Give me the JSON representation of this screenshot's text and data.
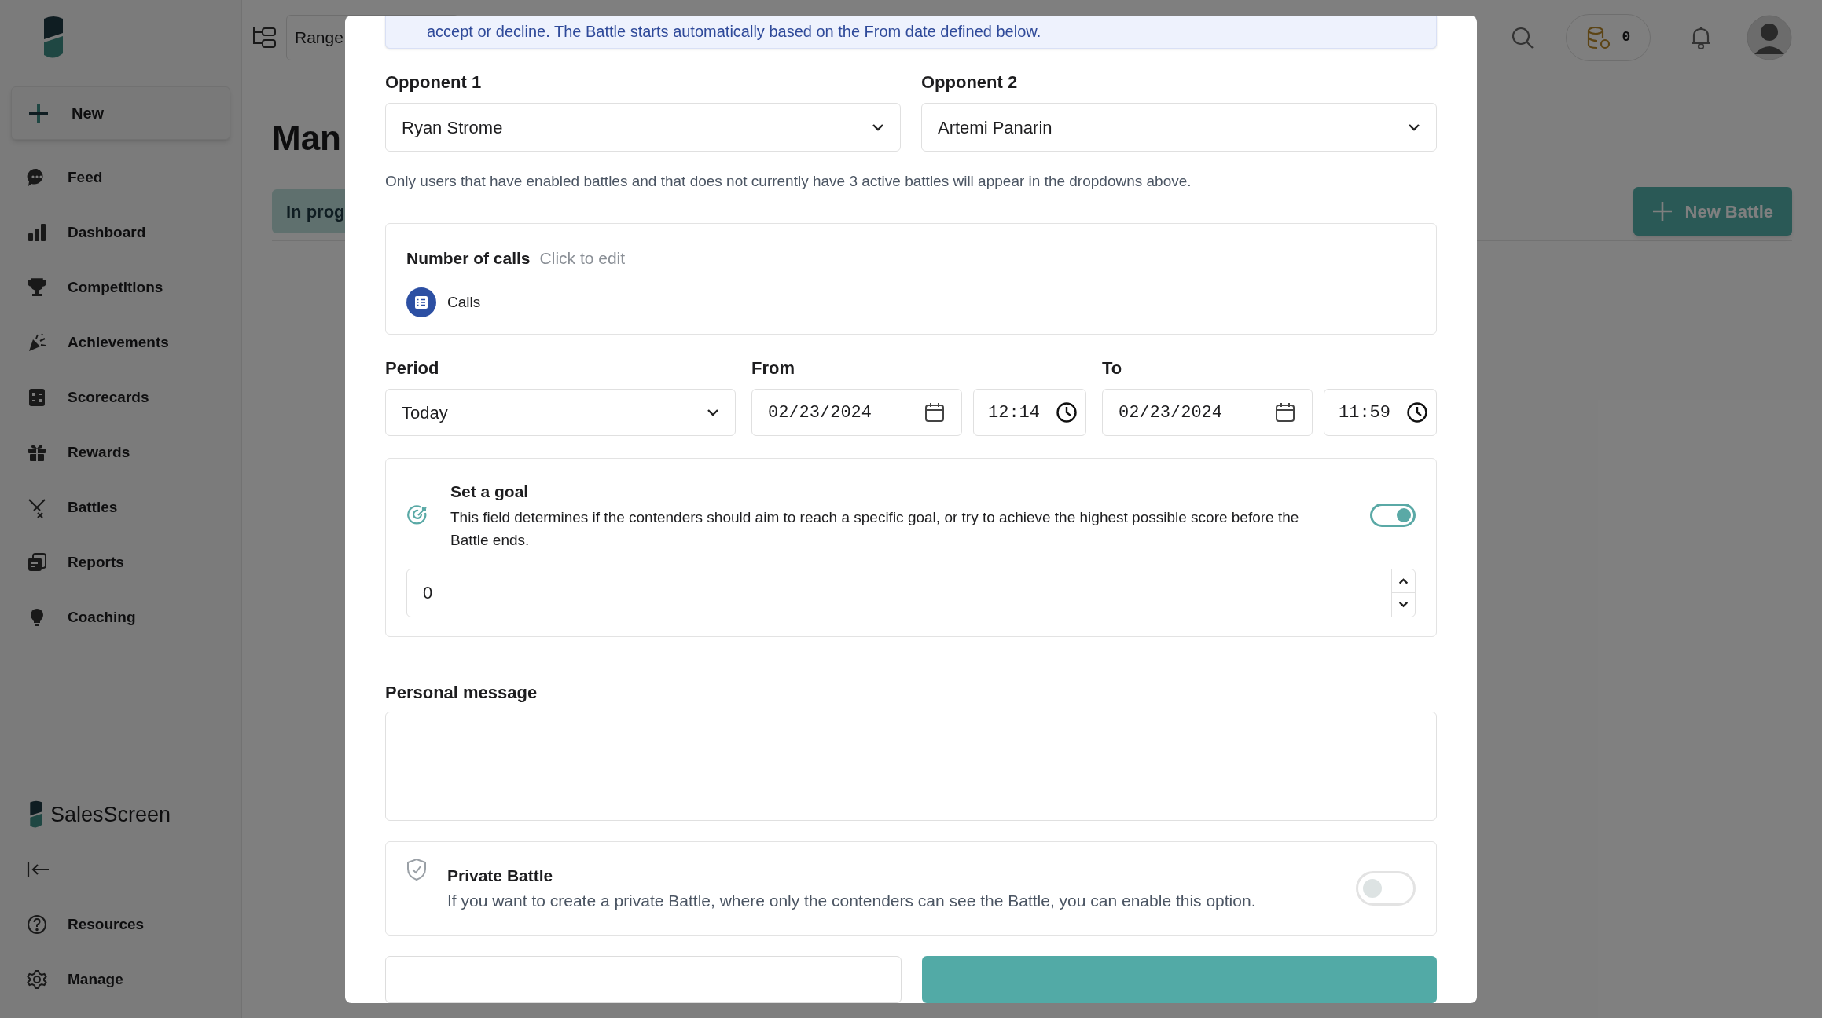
{
  "sidebar": {
    "new_button": "New",
    "items": [
      {
        "label": "Feed"
      },
      {
        "label": "Dashboard"
      },
      {
        "label": "Competitions"
      },
      {
        "label": "Achievements"
      },
      {
        "label": "Scorecards"
      },
      {
        "label": "Rewards"
      },
      {
        "label": "Battles"
      },
      {
        "label": "Reports"
      },
      {
        "label": "Coaching"
      }
    ],
    "brand": "SalesScreen",
    "bottom_items": [
      {
        "label": "Resources"
      },
      {
        "label": "Manage"
      }
    ]
  },
  "header": {
    "range_label": "Range",
    "coins": "0"
  },
  "page": {
    "title": "Man",
    "tabs": [
      {
        "label": "In prog",
        "selected": true
      }
    ],
    "new_button": "New Battle"
  },
  "modal": {
    "notice": "accept or decline. The Battle starts automatically based on the From date defined below.",
    "opponents": [
      {
        "label": "Opponent 1",
        "value": "Ryan Strome"
      },
      {
        "label": "Opponent 2",
        "value": "Artemi Panarin"
      }
    ],
    "opponents_hint": "Only users that have enabled battles and that does not currently have 3 active battles will appear in the dropdowns above.",
    "metric": {
      "title": "Number of calls",
      "edit_hint": "Click to edit",
      "item": "Calls"
    },
    "period": {
      "label": "Period",
      "value": "Today"
    },
    "from": {
      "label": "From",
      "date": "02/23/2024",
      "time": "12:14"
    },
    "to": {
      "label": "To",
      "date": "02/23/2024",
      "time": "11:59"
    },
    "goal": {
      "title": "Set a goal",
      "description": "This field determines if the contenders should aim to reach a specific goal, or try to achieve the highest possible score before the Battle ends.",
      "on": true,
      "value": "0"
    },
    "personal_message": {
      "label": "Personal message"
    },
    "private": {
      "title": "Private Battle",
      "description": "If you want to create a private Battle, where only the contenders can see the Battle, you can enable this option.",
      "on": false
    }
  }
}
